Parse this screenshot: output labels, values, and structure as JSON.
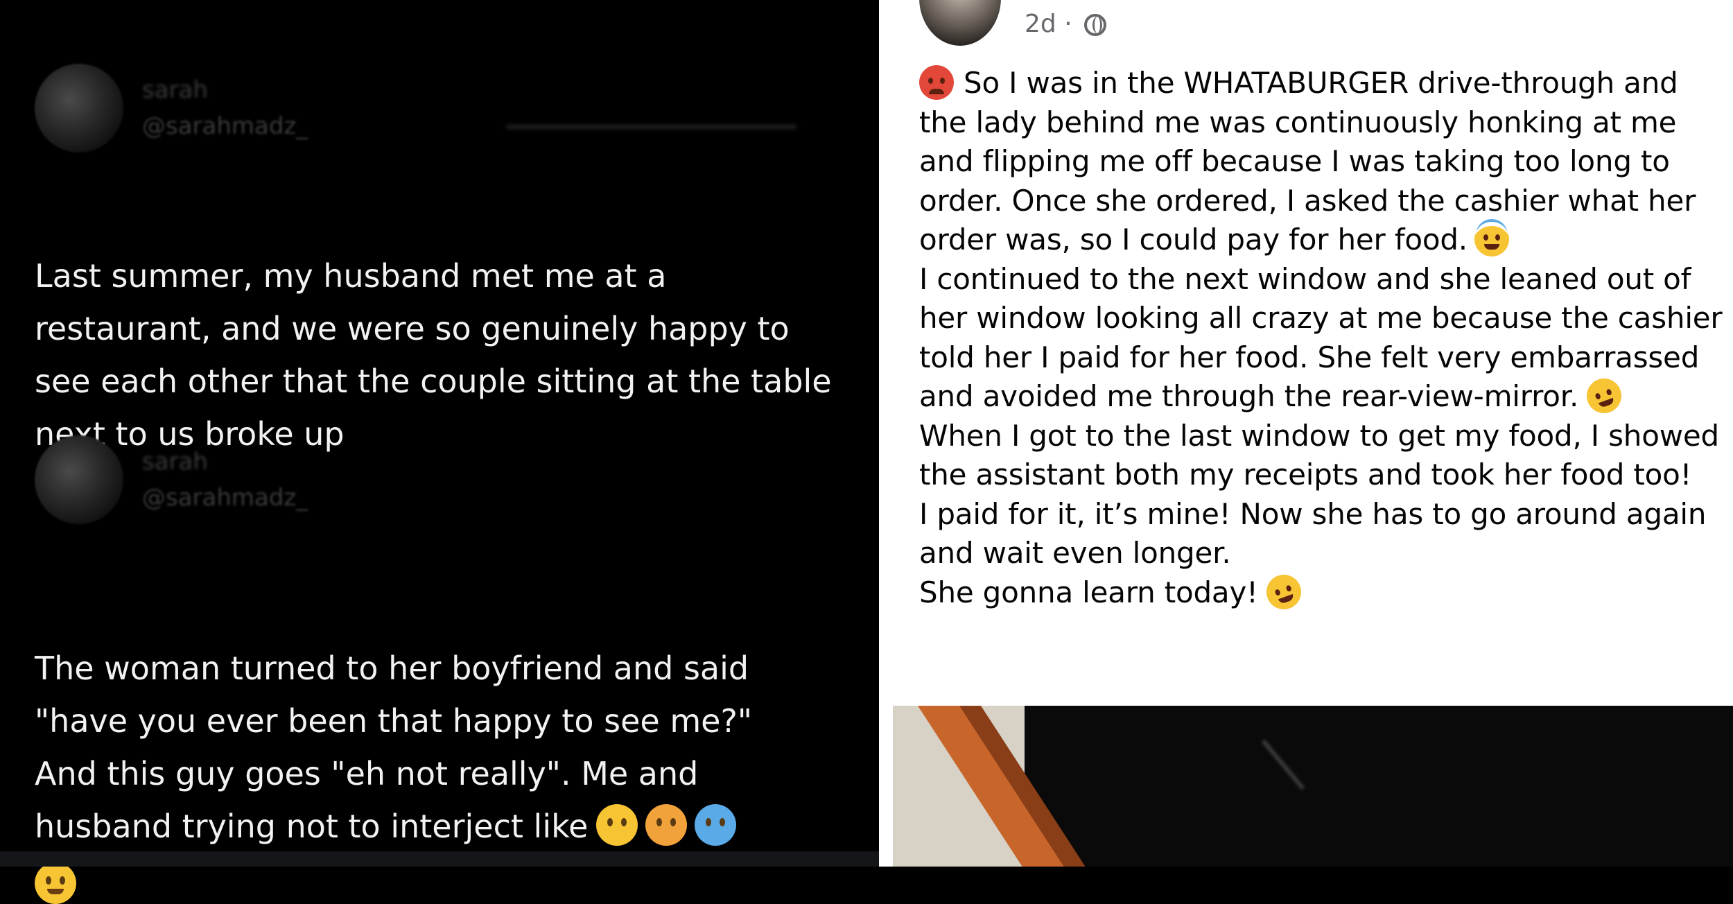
{
  "left": {
    "tweets": [
      {
        "name": "sarah",
        "handle": "@sarahmadz_",
        "text": "Last summer, my husband met me at a restaurant, and we were so genuinely happy to see each other that the couple sitting at the table next to us broke up"
      },
      {
        "name": "sarah",
        "handle": "@sarahmadz_",
        "text": "The woman turned to her boyfriend and said \"have you ever been that happy to see me?\" And this guy goes \"eh not really\". Me and husband trying not to interject like",
        "emojis": [
          "face-with-hand-over-mouth-icon",
          "flushed-face-icon",
          "cold-face-icon",
          "woozy-face-icon"
        ]
      }
    ]
  },
  "right": {
    "meta": "2d ·",
    "paragraphs": [
      "So I was in the WHATABURGER drive-through and the lady behind me was continuously honking at me and flipping me off because I was taking too long to order. Once she ordered, I asked the cashier what her order was, so I could pay for her food.",
      "I continued to the next window and she leaned out of her window looking all crazy at me because the cashier told her I paid for her food. She felt very embarrassed and avoided me through the rear-view-mirror.",
      "When I got to the last window to get my food, I showed the assistant both my receipts and took her food too!",
      "I paid for it, it’s mine! Now she has to go around again and wait even longer.",
      "She gonna learn today!"
    ]
  },
  "colors": {
    "left_bg": "#000000",
    "left_text": "#f2f2f2",
    "right_bg": "#ffffff",
    "right_text": "#050505",
    "meta_text": "#65676b"
  }
}
